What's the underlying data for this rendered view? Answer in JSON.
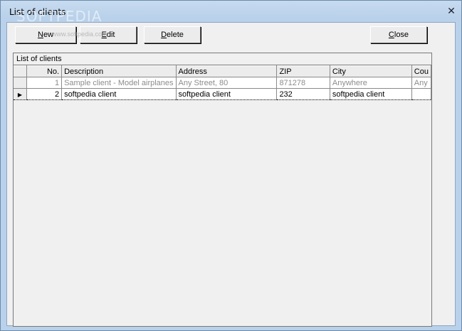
{
  "window": {
    "title": "List of clients",
    "watermark": "SOFTPEDIA",
    "watermark_url": "www.softpedia.com",
    "close_glyph": "✕"
  },
  "toolbar": {
    "new": {
      "hot": "N",
      "rest": "ew"
    },
    "edit": {
      "hot": "E",
      "rest": "dit"
    },
    "delete": {
      "hot": "D",
      "rest": "elete"
    },
    "close": {
      "hot": "C",
      "rest": "lose"
    }
  },
  "panel": {
    "header": "List of clients"
  },
  "table": {
    "columns": [
      "No.",
      "Description",
      "Address",
      "ZIP",
      "City",
      "Cou"
    ],
    "rows": [
      {
        "no": "1",
        "description": "Sample client - Model airplanes",
        "address": "Any Street, 80",
        "zip": "871278",
        "city": "Anywhere",
        "country": "Any"
      },
      {
        "no": "2",
        "description": "softpedia client",
        "address": "softpedia client",
        "zip": "232",
        "city": "softpedia client",
        "country": ""
      }
    ],
    "current_row_marker": "▶"
  }
}
